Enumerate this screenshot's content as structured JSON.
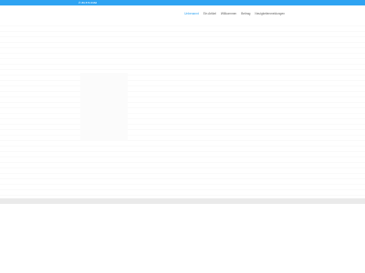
{
  "colors": {
    "accent": "#2ea3f2",
    "nav_text": "#666666",
    "footer_band": "#eaeaea"
  },
  "topbar": {
    "icon": "phone-icon",
    "text": "89 876 6666"
  },
  "nav": {
    "items": [
      {
        "label": "Unbenannt",
        "active": true
      },
      {
        "label": "Ein Artikel",
        "active": false
      },
      {
        "label": "Willkommen",
        "active": false
      },
      {
        "label": "Beitrag",
        "active": false
      },
      {
        "label": "Neuigkeitenmeldungen",
        "active": false
      }
    ]
  }
}
